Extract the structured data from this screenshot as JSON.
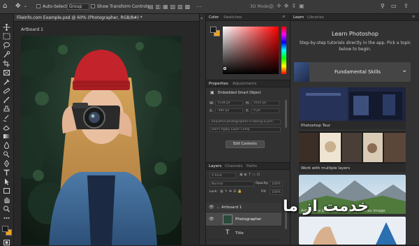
{
  "options_bar": {
    "auto_select_label": "Auto-Select:",
    "auto_select_value": "Group",
    "transform_label": "Show Transform Controls",
    "mode_3d": "3D Mode:"
  },
  "document": {
    "tab_title": "FileInfo.com Example.psd @ 60% (Photographer, RGB/8#) *",
    "artboard_label": "Artboard 1"
  },
  "color_panel": {
    "tabs": [
      "Color",
      "Swatches"
    ],
    "foreground": "#1a1a1a",
    "background": "#f3a21a",
    "hue": "#ff0000"
  },
  "properties_panel": {
    "tabs": [
      "Properties",
      "Adjustments"
    ],
    "kind": "Embedded Smart Object",
    "w_label": "W:",
    "w_value": "1538 px",
    "h_label": "H:",
    "h_value": "1025 px",
    "x_label": "X:",
    "x_value": "-385 px",
    "y_label": "Y:",
    "y_value": "0 px",
    "filename": "beautiful-photographer-is-taking-a-pict...",
    "layer_comp": "Don't Apply Layer Comp",
    "edit_button": "Edit Contents"
  },
  "layers_panel": {
    "tabs": [
      "Layers",
      "Channels",
      "Paths"
    ],
    "filter": "Kind",
    "blend_mode": "Normal",
    "opacity_label": "Opacity:",
    "opacity_value": "100%",
    "lock_label": "Lock:",
    "fill_label": "Fill:",
    "fill_value": "100%",
    "layers": [
      {
        "name": "Artboard 1"
      },
      {
        "name": "Photographer"
      },
      {
        "name": "Title"
      }
    ]
  },
  "learn_panel": {
    "tabs": [
      "Learn",
      "Libraries"
    ],
    "title": "Learn Photoshop",
    "description": "Step-by-step tutorials directly in the app. Pick a topic below to begin.",
    "section": "Fundamental Skills",
    "cards": [
      {
        "caption": "Photoshop Tour"
      },
      {
        "caption": "Work with multiple layers"
      },
      {
        "caption": "Adjust the brightness and color of an image"
      }
    ]
  },
  "watermark": {
    "text": "خدمت از ما"
  }
}
